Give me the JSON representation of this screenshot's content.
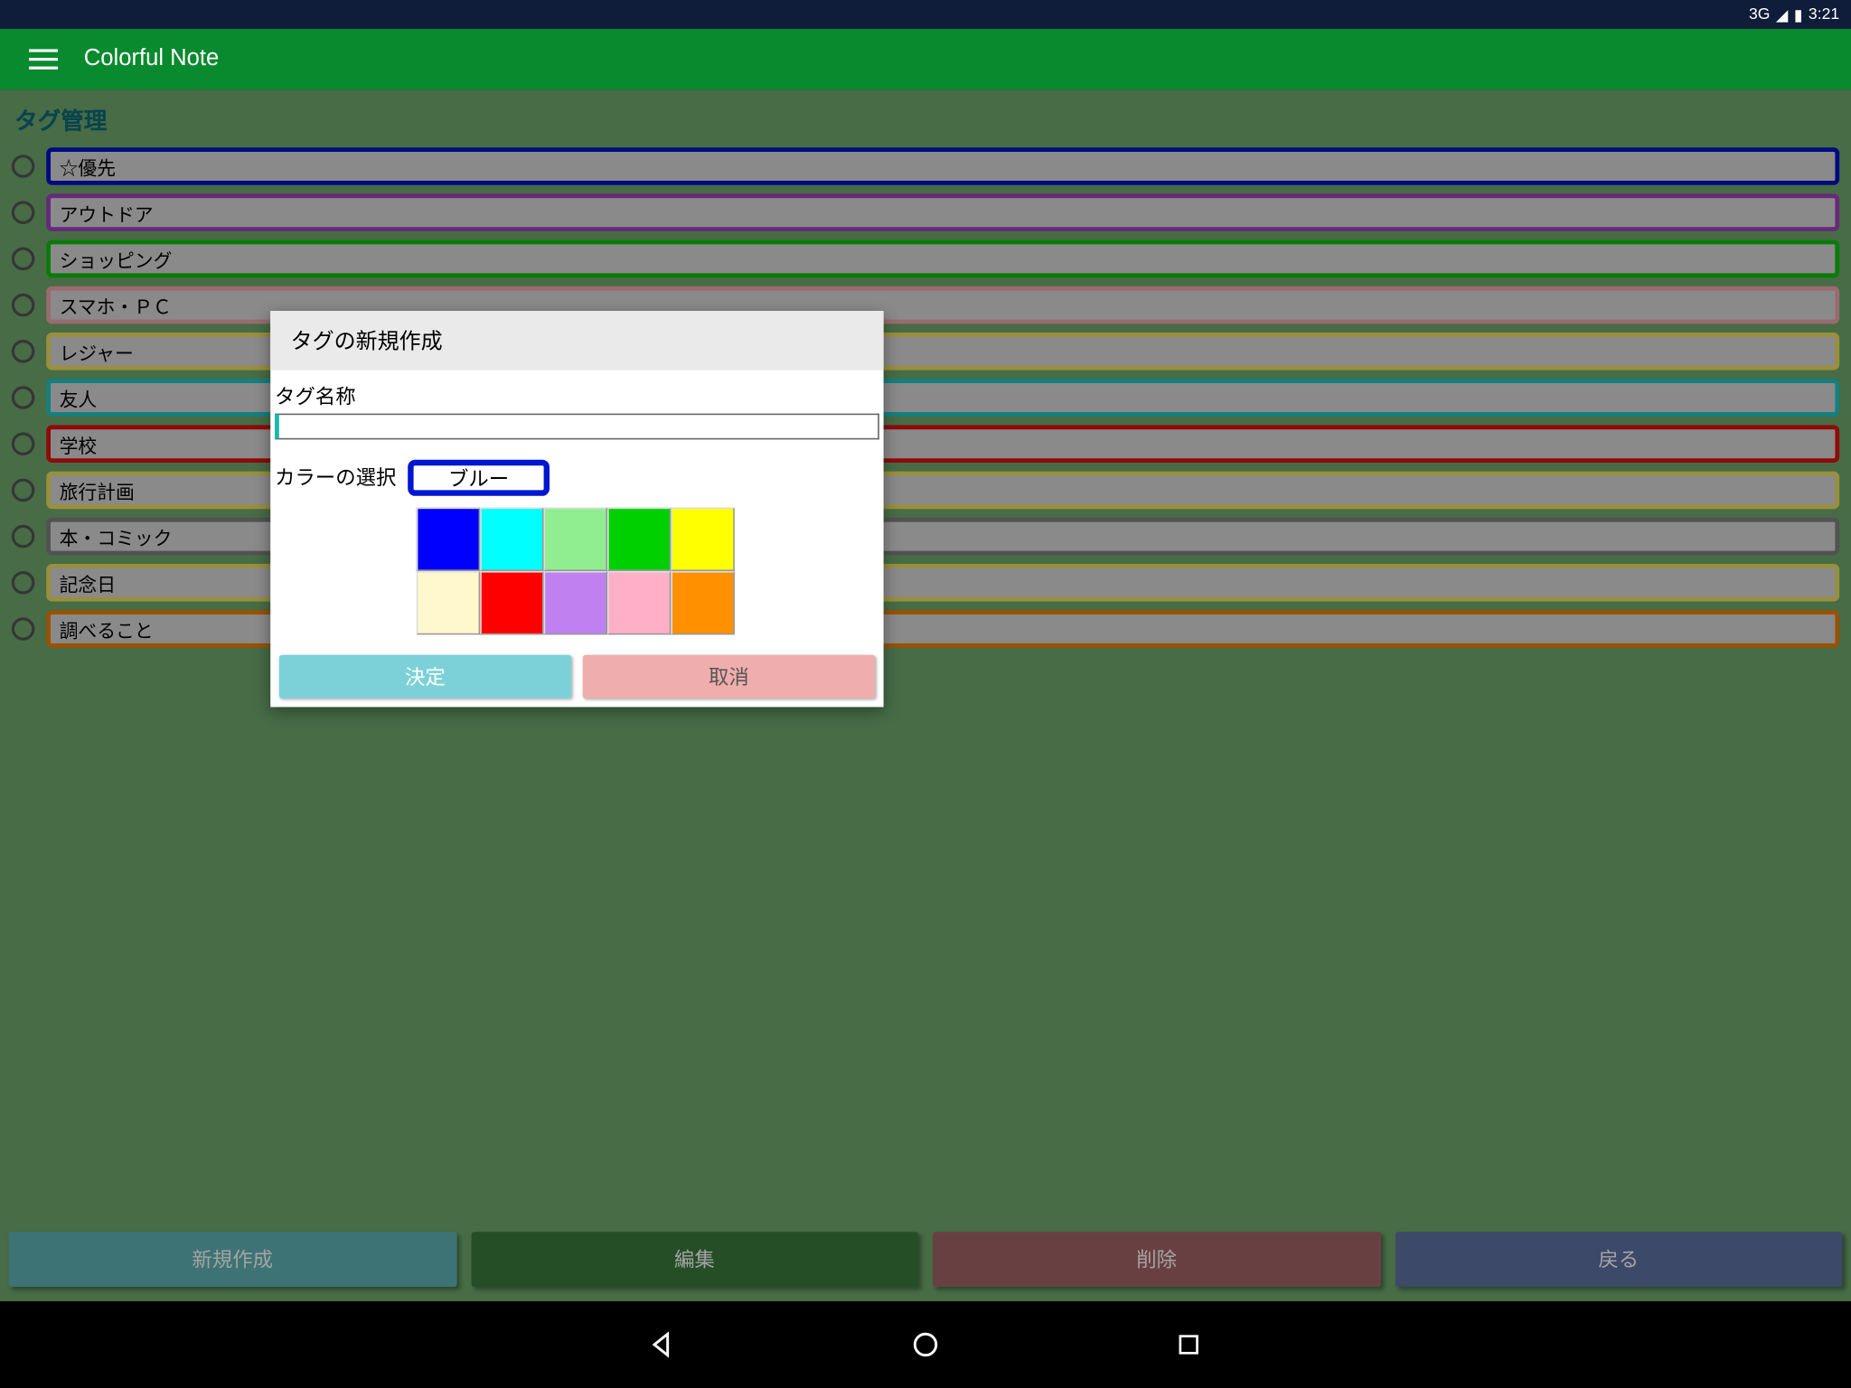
{
  "status": {
    "net": "3G",
    "time": "3:21"
  },
  "app": {
    "title": "Colorful Note"
  },
  "section_title": "タグ管理",
  "tags": [
    {
      "label": "☆優先",
      "color": "#0010c8"
    },
    {
      "label": "アウトドア",
      "color": "#a040c0"
    },
    {
      "label": "ショッピング",
      "color": "#10c010"
    },
    {
      "label": "スマホ・ＰＣ",
      "color": "#f0a8b0"
    },
    {
      "label": "レジャー",
      "color": "#f0e060"
    },
    {
      "label": "友人",
      "color": "#20c8c8"
    },
    {
      "label": "学校",
      "color": "#e01010"
    },
    {
      "label": "旅行計画",
      "color": "#f0e060"
    },
    {
      "label": "本・コミック",
      "color": "#808080"
    },
    {
      "label": "記念日",
      "color": "#f0e060"
    },
    {
      "label": "調べること",
      "color": "#f08000"
    }
  ],
  "bottom_buttons": {
    "new": "新規作成",
    "edit": "編集",
    "del": "削除",
    "back": "戻る"
  },
  "dialog": {
    "title": "タグの新規作成",
    "name_label": "タグ名称",
    "name_value": "",
    "color_label": "カラーの選択",
    "selected_color_name": "ブルー",
    "swatches": [
      [
        "#0000ff",
        "#00ffff",
        "#90ee90",
        "#00d000",
        "#ffff00"
      ],
      [
        "#fff8cc",
        "#ff0000",
        "#c080f0",
        "#ffb0c8",
        "#ff9000"
      ]
    ],
    "ok": "決定",
    "cancel": "取消"
  }
}
